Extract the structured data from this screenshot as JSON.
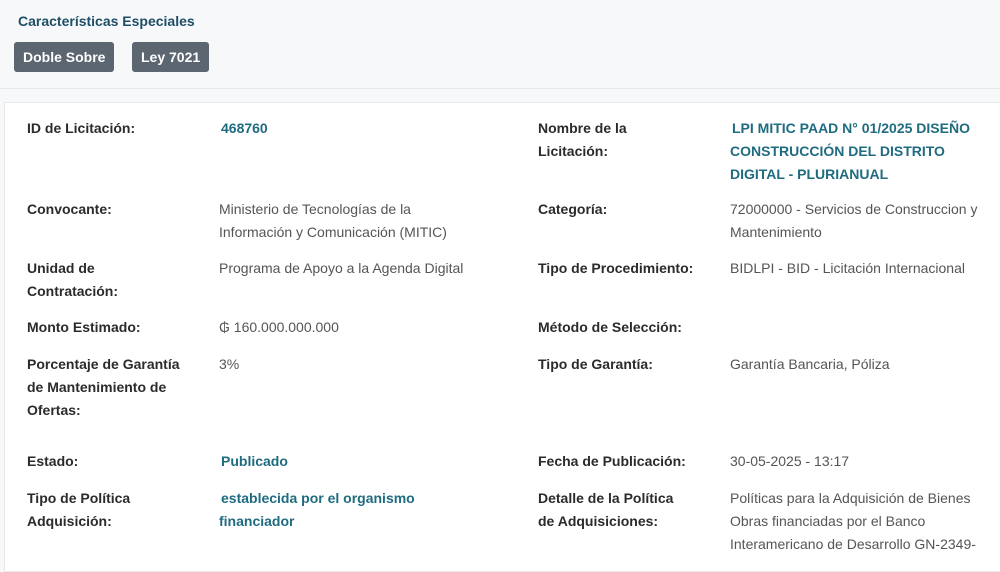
{
  "special": {
    "title": "Características Especiales",
    "badges": [
      "Doble Sobre",
      "Ley 7021"
    ]
  },
  "fields": {
    "id": {
      "label": "ID de Licitación:",
      "value": "468760"
    },
    "nombre": {
      "label_l1": "Nombre de la",
      "label_l2": "Licitación:",
      "value_l1": "LPI MITIC PAAD N° 01/2025 DISEÑO",
      "value_l2": "CONSTRUCCIÓN DEL DISTRITO",
      "value_l3": "DIGITAL - PLURIANUAL"
    },
    "convocante": {
      "label": "Convocante:",
      "value_l1": "Ministerio de Tecnologías de la",
      "value_l2": "Información y Comunicación (MITIC)"
    },
    "categoria": {
      "label": "Categoría:",
      "value_l1": "72000000 - Servicios de Construccion y",
      "value_l2": "Mantenimiento"
    },
    "unidad": {
      "label_l1": "Unidad de",
      "label_l2": "Contratación:",
      "value": "Programa de Apoyo a la Agenda Digital"
    },
    "tipo_proc": {
      "label": "Tipo de Procedimiento:",
      "value": "BIDLPI - BID - Licitación Internacional"
    },
    "monto": {
      "label": "Monto Estimado:",
      "value": "₲ 160.000.000.000"
    },
    "metodo": {
      "label": "Método de Selección:",
      "value": ""
    },
    "porcentaje": {
      "label_l1": "Porcentaje de Garantía",
      "label_l2": "de Mantenimiento de",
      "label_l3": "Ofertas:",
      "value": "3%"
    },
    "tipo_gar": {
      "label": "Tipo de Garantía:",
      "value": "Garantía Bancaria, Póliza"
    },
    "estado": {
      "label": "Estado:",
      "value": "Publicado"
    },
    "fecha": {
      "label": "Fecha de Publicación:",
      "value": "30-05-2025 - 13:17"
    },
    "politica": {
      "label_l1": "Tipo de Política",
      "label_l2": "Adquisición:",
      "value_l1": "establecida por el organismo",
      "value_l2": "financiador"
    },
    "detalle": {
      "label_l1": "Detalle de la Política",
      "label_l2": "de Adquisiciones:",
      "value_l1": "Políticas para la Adquisición de Bienes",
      "value_l2": "Obras financiadas por el Banco",
      "value_l3": "Interamericano de Desarrollo GN-2349-"
    }
  }
}
